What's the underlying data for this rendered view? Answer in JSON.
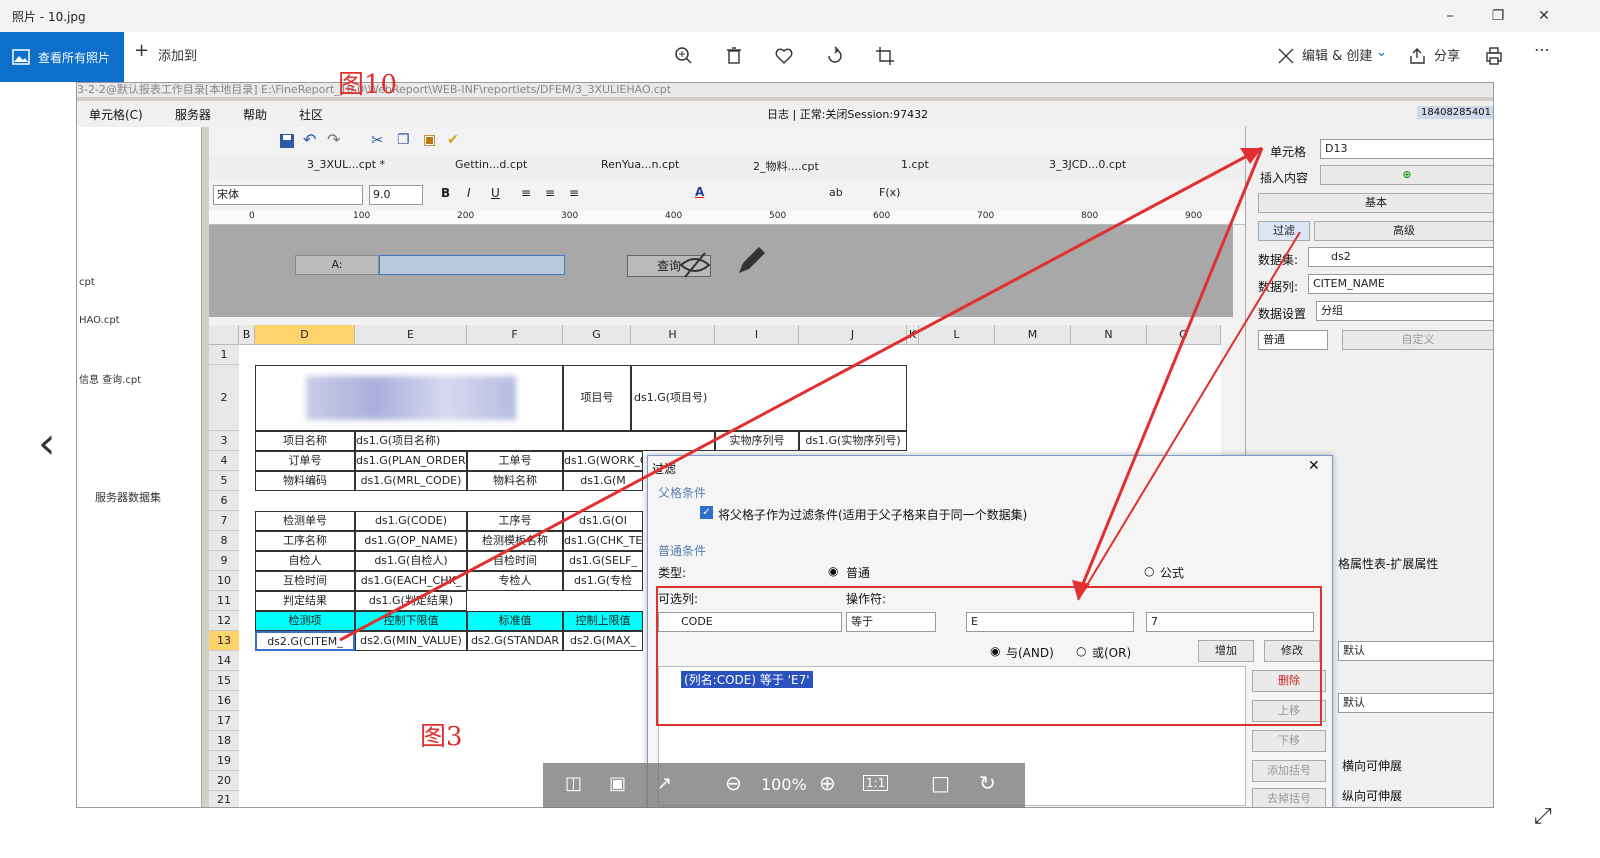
{
  "photos_app": {
    "title": "照片 - 10.jpg",
    "view_all_label": "查看所有照片",
    "add_to_label": "添加到",
    "edit_create_label": "编辑 & 创建",
    "share_label": "分享",
    "zoom_level": "100%"
  },
  "annotations": {
    "fig10": "图10",
    "fig3": "图3"
  },
  "designer": {
    "frame_title": "3-2-2@默认报表工作目录[本地目录]   E:\\FineReport_10.0\\WebReport\\WEB-INF\\reportlets/DFEM/3_3XULIEHAO.cpt",
    "menu": [
      "单元格(C)",
      "服务器",
      "帮助",
      "社区"
    ],
    "status": "日志 | 正常:关闭Session:97432",
    "user": "18408285401",
    "tabs": [
      "3_3XUL...cpt *",
      "Gettin...d.cpt",
      "RenYua...n.cpt",
      "2_物料....cpt",
      "1.cpt",
      "3_3JCD...0.cpt"
    ],
    "font_name": "宋体",
    "font_size": "9.0",
    "ruler": [
      "0",
      "100",
      "200",
      "300",
      "400",
      "500",
      "600",
      "700",
      "800",
      "900"
    ],
    "param_label": "A:",
    "query_label": "查询",
    "left_items": [
      "cpt",
      "HAO.cpt",
      "信息 查询.cpt",
      "服务器数据集"
    ]
  },
  "grid": {
    "columns": [
      "B",
      "D",
      "E",
      "F",
      "G",
      "H",
      "I",
      "J",
      "K",
      "L",
      "M",
      "N",
      "O"
    ],
    "rows": [
      "1",
      "2",
      "3",
      "4",
      "5",
      "6",
      "7",
      "8",
      "9",
      "10",
      "11",
      "12",
      "13",
      "14",
      "15",
      "16",
      "17",
      "18",
      "19",
      "20",
      "21"
    ],
    "cells": {
      "r2_proj_label": "项目号",
      "r2_proj_val": "ds1.G(项目号)",
      "r3_name_label": "项目名称",
      "r3_name_val": "ds1.G(项目名称)",
      "r3_serial_label": "实物序列号",
      "r3_serial_val": "ds1.G(实物序列号)",
      "r4_order_label": "订单号",
      "r4_order_val": "ds1.G(PLAN_ORDER_",
      "r4_work_label": "工单号",
      "r4_work_val": "ds1.G(WORK_O",
      "r5_mat_label": "物料编码",
      "r5_mat_val": "ds1.G(MRL_CODE)",
      "r5_matname_label": "物料名称",
      "r5_matname_val": "ds1.G(M",
      "r7_check_label": "检测单号",
      "r7_check_val": "ds1.G(CODE)",
      "r7_proc_label": "工序号",
      "r7_proc_val": "ds1.G(OI",
      "r8_op_label": "工序名称",
      "r8_op_val": "ds1.G(OP_NAME)",
      "r8_tpl_label": "检测模板名称",
      "r8_tpl_val": "ds1.G(CHK_TE",
      "r9_self_label": "自检人",
      "r9_self_val": "ds1.G(自检人)",
      "r9_time_label": "自检时间",
      "r9_time_val": "ds1.G(SELF_",
      "r10_mutual_label": "互检时间",
      "r10_mutual_val": "ds1.G(EACH_CHK_",
      "r10_spec_label": "专检人",
      "r10_spec_val": "ds1.G(专检",
      "r11_result_label": "判定结果",
      "r11_result_val": "ds1.G(判定结果)",
      "r12_item": "检测项",
      "r12_low": "控制下限值",
      "r12_std": "标准值",
      "r12_high": "控制上限值",
      "r13_item": "ds2.G(CITEM_",
      "r13_low": "ds2.G(MIN_VALUE)",
      "r13_std": "ds2.G(STANDAR",
      "r13_high": "ds2.G(MAX_"
    }
  },
  "right_panel": {
    "cell_label": "单元格",
    "cell_value": "D13",
    "insert_label": "插入内容",
    "basic_btn": "基本",
    "filter_btn": "过滤",
    "advanced_btn": "高级",
    "dataset_label": "数据集:",
    "dataset_value": "ds2",
    "datacol_label": "数据列:",
    "datacol_value": "CITEM_NAME",
    "dataset_setting_label": "数据设置",
    "dataset_setting_value": "分组",
    "mode_value": "普通",
    "custom_btn": "自定义",
    "ext_title": "格属性表-扩展属性",
    "default1": "默认",
    "default2": "默认",
    "h_extend": "横向可伸展",
    "v_extend": "纵向可伸展"
  },
  "filter_dialog": {
    "title": "过滤",
    "parent_group": "父格条件",
    "parent_checkbox_label": "将父格子作为过滤条件(适用于父子格来自于同一个数据集)",
    "common_group": "普通条件",
    "type_label": "类型:",
    "type_normal": "普通",
    "type_formula": "公式",
    "col_label": "可选列:",
    "op_label": "操作符:",
    "col_value": "CODE",
    "op_value": "等于",
    "val1": "E",
    "val2": "7",
    "and_label": "与(AND)",
    "or_label": "或(OR)",
    "add_btn": "增加",
    "modify_btn": "修改",
    "condition_text": "(列名:CODE) 等于 'E7'",
    "delete_btn": "删除",
    "up_btn": "上移",
    "down_btn": "下移",
    "add_bracket_btn": "添加括号",
    "remove_bracket_btn": "去掉括号"
  },
  "colors": {
    "accent": "#0b6fcb",
    "annotation_red": "#e03030",
    "cyan": "#00ffff"
  }
}
